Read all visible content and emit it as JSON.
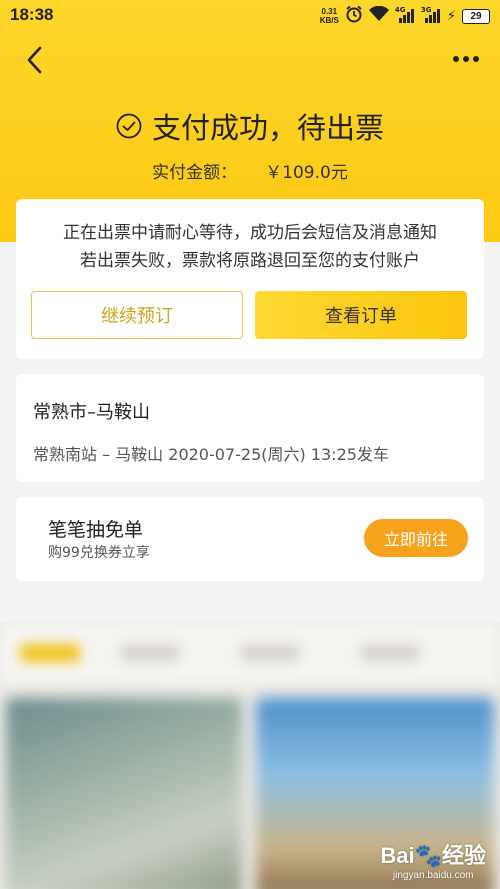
{
  "status_bar": {
    "time": "18:38",
    "net_speed_value": "0.31",
    "net_speed_unit": "KB/S",
    "signal1_tag": "4G",
    "signal2_tag": "3G",
    "battery": "29",
    "icons": [
      "alarm-icon",
      "wifi-icon",
      "signal-icon",
      "charging-icon",
      "battery-icon"
    ]
  },
  "nav": {
    "back_icon": "chevron-left-icon",
    "more_icon": "more-icon"
  },
  "header": {
    "title": "支付成功，待出票",
    "amount_label": "实付金额：",
    "amount_value": "￥109.0元",
    "accent_color": "#fcd62a"
  },
  "notice": {
    "line1": "正在出票中请耐心等待，成功后会短信及消息通知",
    "line2": "若出票失败，票款将原路退回至您的支付账户",
    "continue_button": "继续预订",
    "view_order_button": "查看订单"
  },
  "trip": {
    "route": "常熟市–马鞍山",
    "detail": "常熟南站 – 马鞍山  2020-07-25(周六) 13:25发车"
  },
  "promo": {
    "title": "笔笔抽免单",
    "subtitle": "购99兑换券立享",
    "button": "立即前往",
    "button_color": "#f7a21b"
  },
  "watermark": {
    "logo": "Bai🐾经验",
    "url": "jingyan.baidu.com"
  }
}
